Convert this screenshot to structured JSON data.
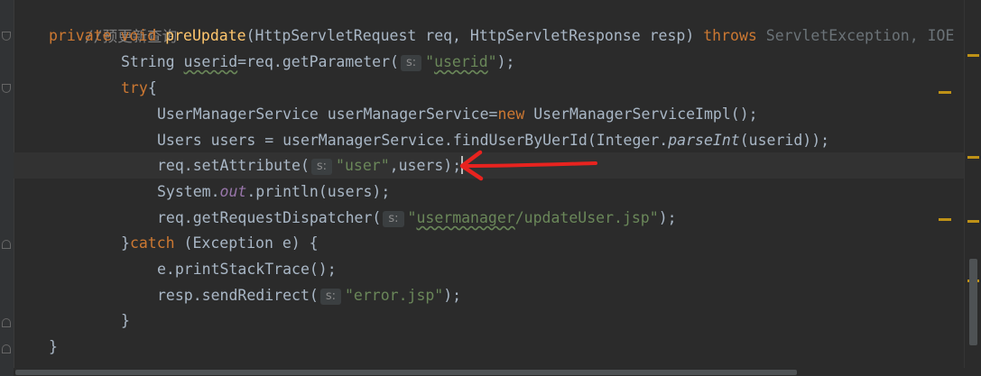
{
  "editor": {
    "language": "java",
    "lines": {
      "l1": {
        "comment": "//预更新查询"
      },
      "l2": {
        "kw_private": "private",
        "kw_void": "void",
        "method": "preUpdate",
        "params": "(HttpServletRequest req, HttpServletResponse resp) ",
        "kw_throws": "throws",
        "throws_rest": " ServletException, IOE"
      },
      "l3": {
        "pre": "String ",
        "var": "userid",
        "mid": "=req.getParameter(",
        "hint": "s:",
        "str_open": "\"",
        "str_val": "userid",
        "str_close": "\"",
        "post": ");"
      },
      "l4": {
        "kw": "try",
        "post": "{"
      },
      "l5": {
        "pre": "UserManagerService userManagerService=",
        "kw": "new",
        "post": " UserManagerServiceImpl();"
      },
      "l6": {
        "pre": "Users users = userManagerService.findUserByUerId(Integer.",
        "ital": "parseInt",
        "post": "(userid));"
      },
      "l7": {
        "pre": "req.setAttribute(",
        "hint": "s:",
        "str": "\"user\"",
        "post": ",users);"
      },
      "l8": {
        "pre": "System.",
        "field": "out",
        "post": ".println(users);"
      },
      "l9": {
        "pre": "req.getRequestDispatcher(",
        "hint": "s:",
        "str_open": "\"",
        "str_val": "usermanager",
        "str_close": "/updateUser.jsp\"",
        "post": ");"
      },
      "l10": {
        "brace": "}",
        "kw": "catch",
        "post": " (Exception e) {"
      },
      "l11": {
        "text": "e.printStackTrace();"
      },
      "l12": {
        "pre": "resp.sendRedirect(",
        "hint": "s:",
        "str": "\"error.jsp\"",
        "post": ");"
      },
      "l13": {
        "text": "}"
      },
      "l14": {
        "text": "}"
      }
    }
  },
  "colors": {
    "background": "#2b2b2b",
    "keyword": "#cc7832",
    "method": "#ffc66d",
    "string": "#6a8759",
    "comment": "#808080",
    "annotation_arrow": "#e8231f"
  },
  "icons": {
    "arrow": "red-hand-drawn-arrow-icon",
    "fold": "fold-marker-icon"
  }
}
